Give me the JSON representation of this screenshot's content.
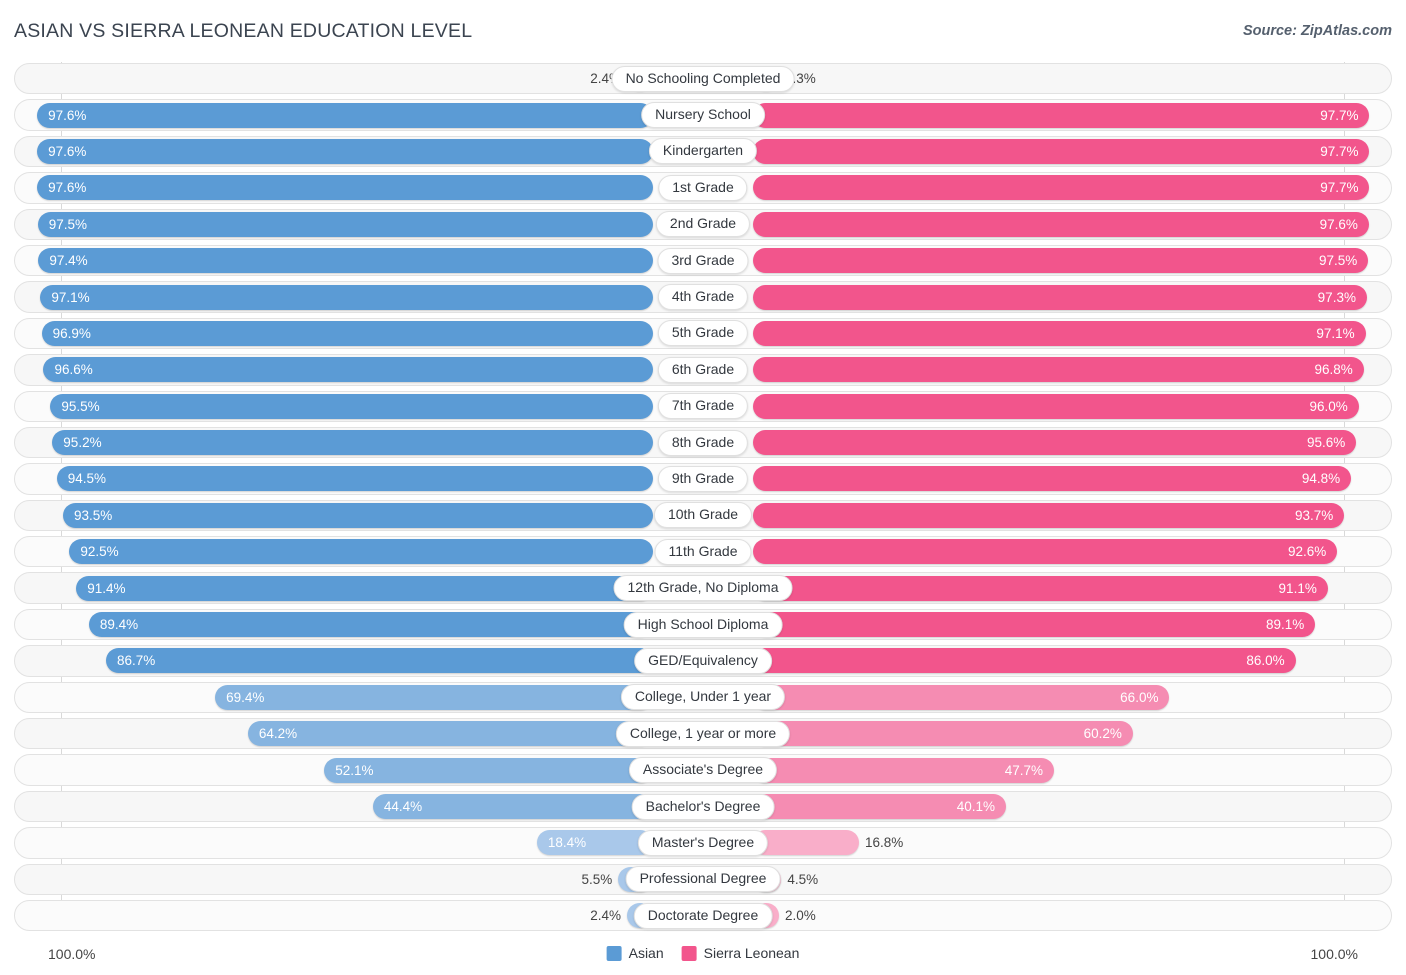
{
  "header": {
    "title": "ASIAN VS SIERRA LEONEAN EDUCATION LEVEL",
    "source": "Source: ZipAtlas.com"
  },
  "footer": {
    "axis_left": "100.0%",
    "axis_right": "100.0%",
    "legend": [
      {
        "label": "Asian",
        "color": "#5b9bd5"
      },
      {
        "label": "Sierra Leonean",
        "color": "#f2558c"
      }
    ]
  },
  "colors": {
    "asian_dark": "#5b9bd5",
    "asian_mid": "#86b4e0",
    "asian_light": "#a9c8ea",
    "sl_dark": "#f2558c",
    "sl_mid": "#f58cb2",
    "sl_light": "#f9aec9",
    "track": "#f7f7f7",
    "track_border": "#e2e2e2"
  },
  "chart_data": {
    "type": "bar",
    "orientation": "horizontal-diverging",
    "title": "ASIAN VS SIERRA LEONEAN EDUCATION LEVEL",
    "xlabel": "",
    "ylabel": "",
    "xlim": [
      0,
      100
    ],
    "grid": false,
    "legend_position": "bottom-center",
    "axis_labels": {
      "left": "100.0%",
      "right": "100.0%"
    },
    "categories": [
      "No Schooling Completed",
      "Nursery School",
      "Kindergarten",
      "1st Grade",
      "2nd Grade",
      "3rd Grade",
      "4th Grade",
      "5th Grade",
      "6th Grade",
      "7th Grade",
      "8th Grade",
      "9th Grade",
      "10th Grade",
      "11th Grade",
      "12th Grade, No Diploma",
      "High School Diploma",
      "GED/Equivalency",
      "College, Under 1 year",
      "College, 1 year or more",
      "Associate's Degree",
      "Bachelor's Degree",
      "Master's Degree",
      "Professional Degree",
      "Doctorate Degree"
    ],
    "series": [
      {
        "name": "Asian",
        "color": "#5b9bd5",
        "values": [
          2.4,
          97.6,
          97.6,
          97.6,
          97.5,
          97.4,
          97.1,
          96.9,
          96.6,
          95.5,
          95.2,
          94.5,
          93.5,
          92.5,
          91.4,
          89.4,
          86.7,
          69.4,
          64.2,
          52.1,
          44.4,
          18.4,
          5.5,
          2.4
        ],
        "labels": [
          "2.4%",
          "97.6%",
          "97.6%",
          "97.6%",
          "97.5%",
          "97.4%",
          "97.1%",
          "96.9%",
          "96.6%",
          "95.5%",
          "95.2%",
          "94.5%",
          "93.5%",
          "92.5%",
          "91.4%",
          "89.4%",
          "86.7%",
          "69.4%",
          "64.2%",
          "52.1%",
          "44.4%",
          "18.4%",
          "5.5%",
          "2.4%"
        ]
      },
      {
        "name": "Sierra Leonean",
        "color": "#f2558c",
        "values": [
          2.3,
          97.7,
          97.7,
          97.7,
          97.6,
          97.5,
          97.3,
          97.1,
          96.8,
          96.0,
          95.6,
          94.8,
          93.7,
          92.6,
          91.1,
          89.1,
          86.0,
          66.0,
          60.2,
          47.7,
          40.1,
          16.8,
          4.5,
          2.0
        ],
        "labels": [
          "2.3%",
          "97.7%",
          "97.7%",
          "97.7%",
          "97.6%",
          "97.5%",
          "97.3%",
          "97.1%",
          "96.8%",
          "96.0%",
          "95.6%",
          "94.8%",
          "93.7%",
          "92.6%",
          "91.1%",
          "89.1%",
          "86.0%",
          "66.0%",
          "60.2%",
          "47.7%",
          "40.1%",
          "16.8%",
          "4.5%",
          "2.0%"
        ]
      }
    ]
  }
}
